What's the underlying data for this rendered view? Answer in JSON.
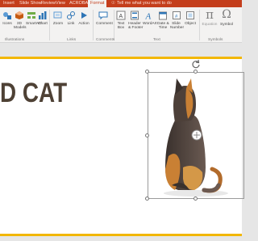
{
  "tabs": [
    "Insert",
    "Slide Show",
    "Review",
    "View",
    "ACROBAT",
    "Format"
  ],
  "tell_me": "Tell me what you want to do",
  "ribbon": {
    "items": [
      {
        "label": "Icons"
      },
      {
        "label": "3D\nModels"
      },
      {
        "label": "SmartArt"
      },
      {
        "label": "Chart"
      },
      {
        "label": "Zoom"
      },
      {
        "label": "Link"
      },
      {
        "label": "Action"
      },
      {
        "label": "Comment"
      },
      {
        "label": "Text\nBox"
      },
      {
        "label": "Header\n& Footer"
      },
      {
        "label": "WordArt"
      },
      {
        "label": "Date &\nTime"
      },
      {
        "label": "Slide\nNumber"
      },
      {
        "label": "Object"
      },
      {
        "label": "Equation"
      },
      {
        "label": "Symbol"
      }
    ],
    "groups": [
      "Illustrations",
      "Links",
      "Comments",
      "Text",
      "Symbols"
    ]
  },
  "slide": {
    "title": "D CAT"
  },
  "colors": {
    "accent": "#c43e1c",
    "slide_rule": "#f2b705",
    "title": "#4e4135"
  }
}
